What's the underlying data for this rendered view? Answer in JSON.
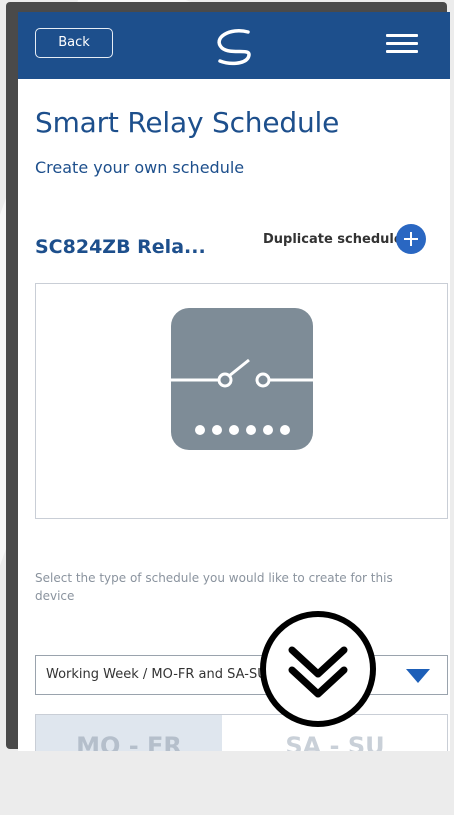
{
  "header": {
    "back_label": "Back",
    "logo_icon": "brand-swirl-logo",
    "menu_icon": "hamburger-menu-icon",
    "background_color": "#1d4f8c"
  },
  "page": {
    "title": "Smart Relay Schedule",
    "subtitle": "Create your own schedule"
  },
  "device": {
    "name": "SC824ZB Rela...",
    "duplicate_label": "Duplicate schedule",
    "duplicate_icon": "plus-circle-icon",
    "image_icon": "relay-switch-icon"
  },
  "schedule_type": {
    "prompt": "Select the type of schedule you would like to create for this device",
    "selected_value": "Working Week / MO-FR and SA-SU",
    "dropdown_icon": "triangle-down-icon"
  },
  "tabs": [
    {
      "label": "MO - FR",
      "active": true
    },
    {
      "label": "SA - SU",
      "active": false
    }
  ],
  "overlay": {
    "icon": "double-chevron-down-icon"
  },
  "colors": {
    "primary": "#1d4f8c",
    "accent": "#2a67c2",
    "icon_gray": "#7e8c97"
  }
}
